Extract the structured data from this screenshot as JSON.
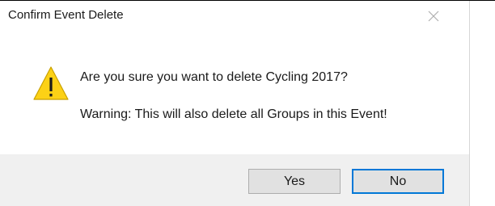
{
  "dialog": {
    "title": "Confirm Event Delete",
    "close_icon": "close-icon",
    "icon": "warning-icon",
    "message": "Are you sure you want to delete Cycling 2017?",
    "warning": "Warning: This will also delete all Groups in this Event!"
  },
  "buttons": {
    "yes_label": "Yes",
    "no_label": "No",
    "default": "No"
  },
  "colors": {
    "footer_background": "#f0f0f0",
    "focus_border": "#0078d7",
    "warning_fill": "#fcd116"
  }
}
